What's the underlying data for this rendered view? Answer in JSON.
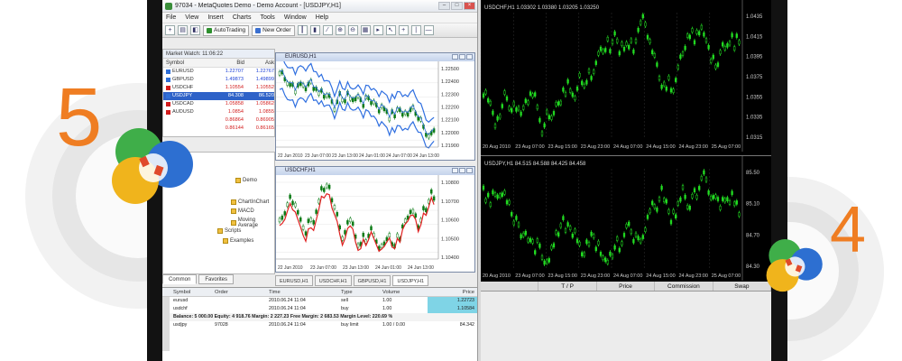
{
  "badges": {
    "left_number": "5",
    "right_number": "4"
  },
  "mt5": {
    "window_title": "97034 - MetaQuotes Demo - Demo Account - [USDJPY,H1]",
    "menu": [
      "File",
      "View",
      "Insert",
      "Charts",
      "Tools",
      "Window",
      "Help"
    ],
    "toolbar": {
      "autotrading_label": "AutoTrading",
      "new_order_label": "New Order"
    },
    "market_watch": {
      "title": "Market Watch: 11:06:22",
      "headers": {
        "symbol": "Symbol",
        "bid": "Bid",
        "ask": "Ask"
      },
      "rows": [
        {
          "symbol": "EURUSD",
          "bid": "1.22707",
          "ask": "1.22767"
        },
        {
          "symbol": "GBPUSD",
          "bid": "1.49873",
          "ask": "1.49899"
        },
        {
          "symbol": "USDCHF",
          "bid": "1.10554",
          "ask": "1.10552"
        },
        {
          "symbol": "USDJPY",
          "bid": "84.308",
          "ask": "86.520"
        },
        {
          "symbol": "USDCAD",
          "bid": "1.05858",
          "ask": "1.05862"
        },
        {
          "symbol": "AUDUSD",
          "bid": "1.0854",
          "ask": "1.0855"
        },
        {
          "symbol": "",
          "bid": "0.86864",
          "ask": "0.86905"
        },
        {
          "symbol": "",
          "bid": "0.86144",
          "ask": "0.86165"
        }
      ]
    },
    "navigator": {
      "items": [
        "Demo",
        "MACD",
        "Moving Average",
        "Scripts",
        "Examples",
        "ChartInChart"
      ],
      "tabs": [
        "Common",
        "Favorites"
      ]
    },
    "charts": [
      {
        "title": "EURUSD,H1",
        "prices": [
          "1.22500",
          "1.22400",
          "1.22300",
          "1.22200",
          "1.22100",
          "1.22000",
          "1.21900"
        ],
        "times": [
          "22 Jun 2010",
          "23 Jun 07:00",
          "23 Jun 13:00",
          "24 Jun 01:00",
          "24 Jun 07:00",
          "24 Jun 13:00"
        ]
      },
      {
        "title": "USDCHF,H1",
        "prices": [
          "1.10800",
          "1.10700",
          "1.10600",
          "1.10500",
          "1.10400"
        ],
        "times": [
          "22 Jun 2010",
          "23 Jun 07:00",
          "23 Jun 13:00",
          "24 Jun 01:00",
          "24 Jun 13:00"
        ],
        "indicator_label": "Stoch(5,3,3)"
      }
    ],
    "chart_tabs": [
      "EURUSD,H1",
      "USDCHF,H1",
      "GBPUSD,H1",
      "USDJPY,H1"
    ],
    "terminal": {
      "headers": {
        "symbol": "Symbol",
        "order": "Order",
        "time": "Time",
        "type": "Type",
        "volume": "Volume",
        "price": "Price"
      },
      "rows": [
        {
          "symbol": "eurusd",
          "order": "",
          "time": "2010.06.24 11:04",
          "type": "sell",
          "volume": "1.00",
          "price": "1.22723",
          "highlight": true
        },
        {
          "symbol": "usdchf",
          "order": "",
          "time": "2010.06.24 11:04",
          "type": "buy",
          "volume": "1.00",
          "price": "1.10584",
          "highlight": true
        }
      ],
      "summary": "Balance: 5 000.00  Equity: 4 918.76  Margin: 2 227.23  Free Margin: 2 683.53  Margin Level: 220.69 %",
      "pending": {
        "symbol": "usdjpy",
        "order": "97028",
        "time": "2010.06.24 11:04",
        "type": "buy limit",
        "volume": "1.00 / 0.00",
        "price": "84.342"
      }
    }
  },
  "mt4": {
    "top_chart": {
      "title": "USDCHF,H1  1.03302 1.03380 1.03205 1.03250",
      "prices": [
        "1.0435",
        "1.0415",
        "1.0395",
        "1.0375",
        "1.0355",
        "1.0335",
        "1.0315"
      ],
      "times": [
        "20 Aug 2010",
        "23 Aug 07:00",
        "23 Aug 15:00",
        "23 Aug 23:00",
        "24 Aug 07:00",
        "24 Aug 15:00",
        "24 Aug 23:00",
        "25 Aug 07:00"
      ]
    },
    "bottom_chart": {
      "title": "USDJPY,H1  84.515 84.588 84.425 84.458",
      "prices": [
        "85.50",
        "85.10",
        "84.70",
        "84.30"
      ],
      "times": [
        "20 Aug 2010",
        "23 Aug 07:00",
        "23 Aug 15:00",
        "23 Aug 23:00",
        "24 Aug 07:00",
        "24 Aug 15:00",
        "24 Aug 23:00",
        "25 Aug 07:00"
      ]
    },
    "terminal_headers": [
      "",
      "T / P",
      "Price",
      "Commission",
      "Swap"
    ]
  },
  "colors": {
    "accent_orange": "#ef7d22",
    "mt4_candle": "#22dd22",
    "band_blue": "#2f6fe0",
    "ma_red": "#e02020"
  }
}
